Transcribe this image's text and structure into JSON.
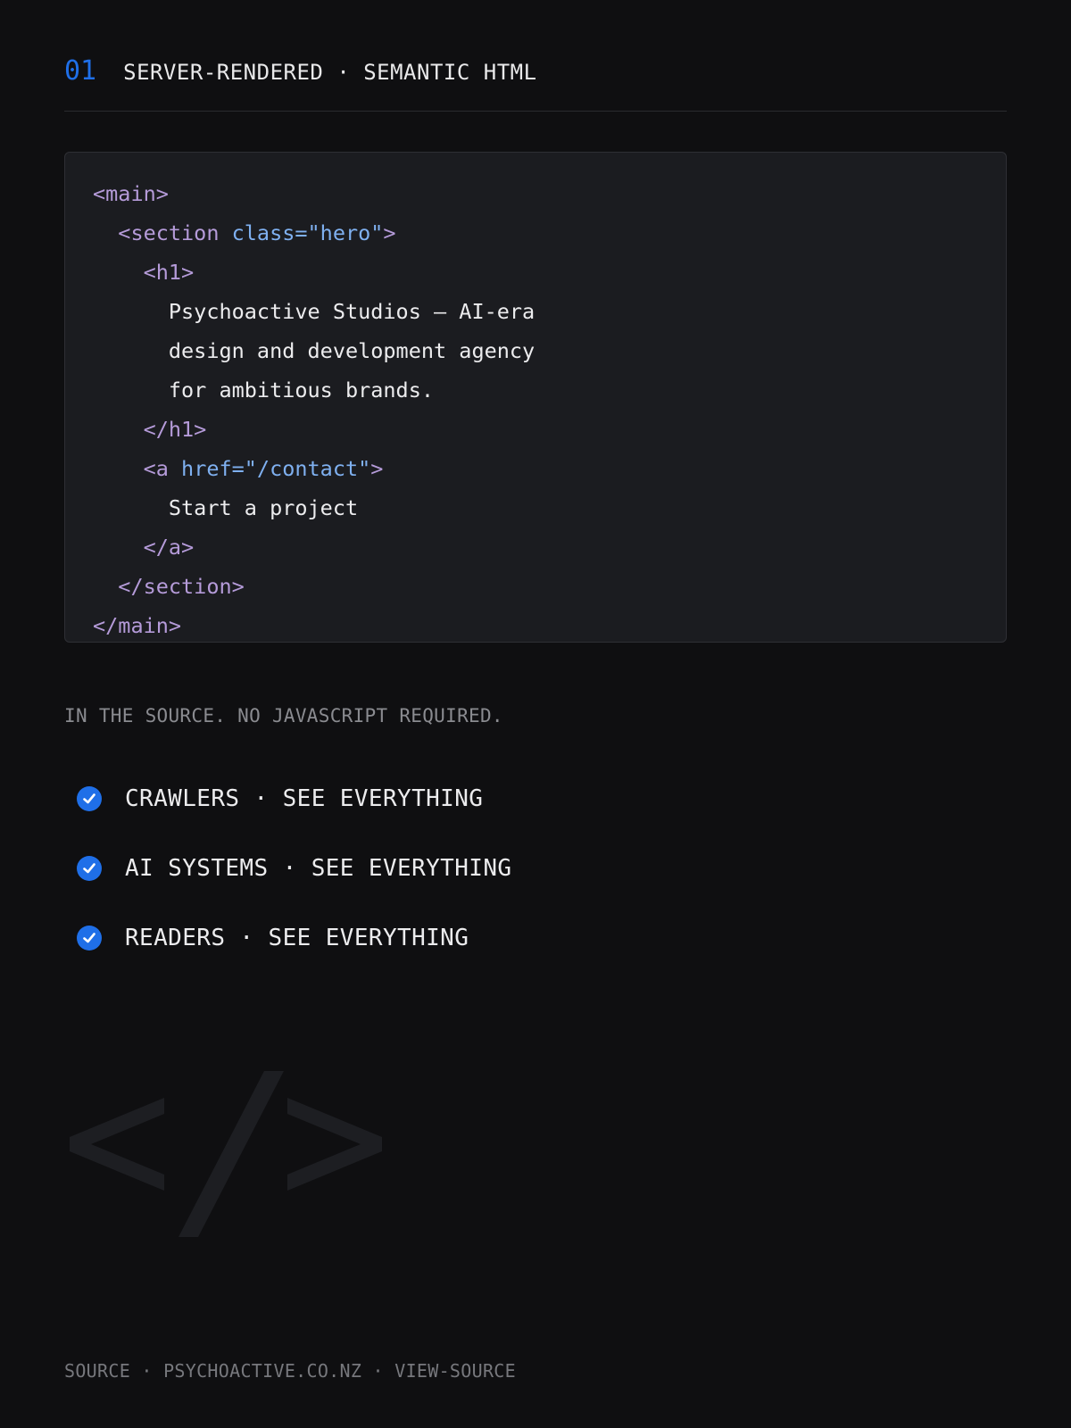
{
  "header": {
    "number": "01",
    "title": "SERVER-RENDERED · SEMANTIC HTML"
  },
  "code": {
    "line1": "<main>",
    "line2_tag_open": "<section ",
    "line2_attr": "class=\"hero\"",
    "line2_tag_close": ">",
    "line3": "<h1>",
    "line4": "Psychoactive Studios — AI-era",
    "line5": "design and development agency",
    "line6": "for ambitious brands.",
    "line7": "</h1>",
    "line8_tag_open": "<a ",
    "line8_attr": "href=\"/contact\"",
    "line8_tag_close": ">",
    "line9": "Start a project",
    "line10": "</a>",
    "line11": "</section>",
    "line12": "</main>"
  },
  "note": "IN THE SOURCE. NO JAVASCRIPT REQUIRED.",
  "checklist": [
    {
      "label": "CRAWLERS · SEE EVERYTHING"
    },
    {
      "label": "AI SYSTEMS · SEE EVERYTHING"
    },
    {
      "label": "READERS · SEE EVERYTHING"
    }
  ],
  "watermark": {
    "icon": "code-slash-icon"
  },
  "footer": "SOURCE · PSYCHOACTIVE.CO.NZ · VIEW-SOURCE",
  "colors": {
    "accent": "#1f6fe8",
    "background": "#0f0f11",
    "code_background": "#1b1c20",
    "tag": "#b59bd9",
    "attribute": "#7fb0f0"
  }
}
